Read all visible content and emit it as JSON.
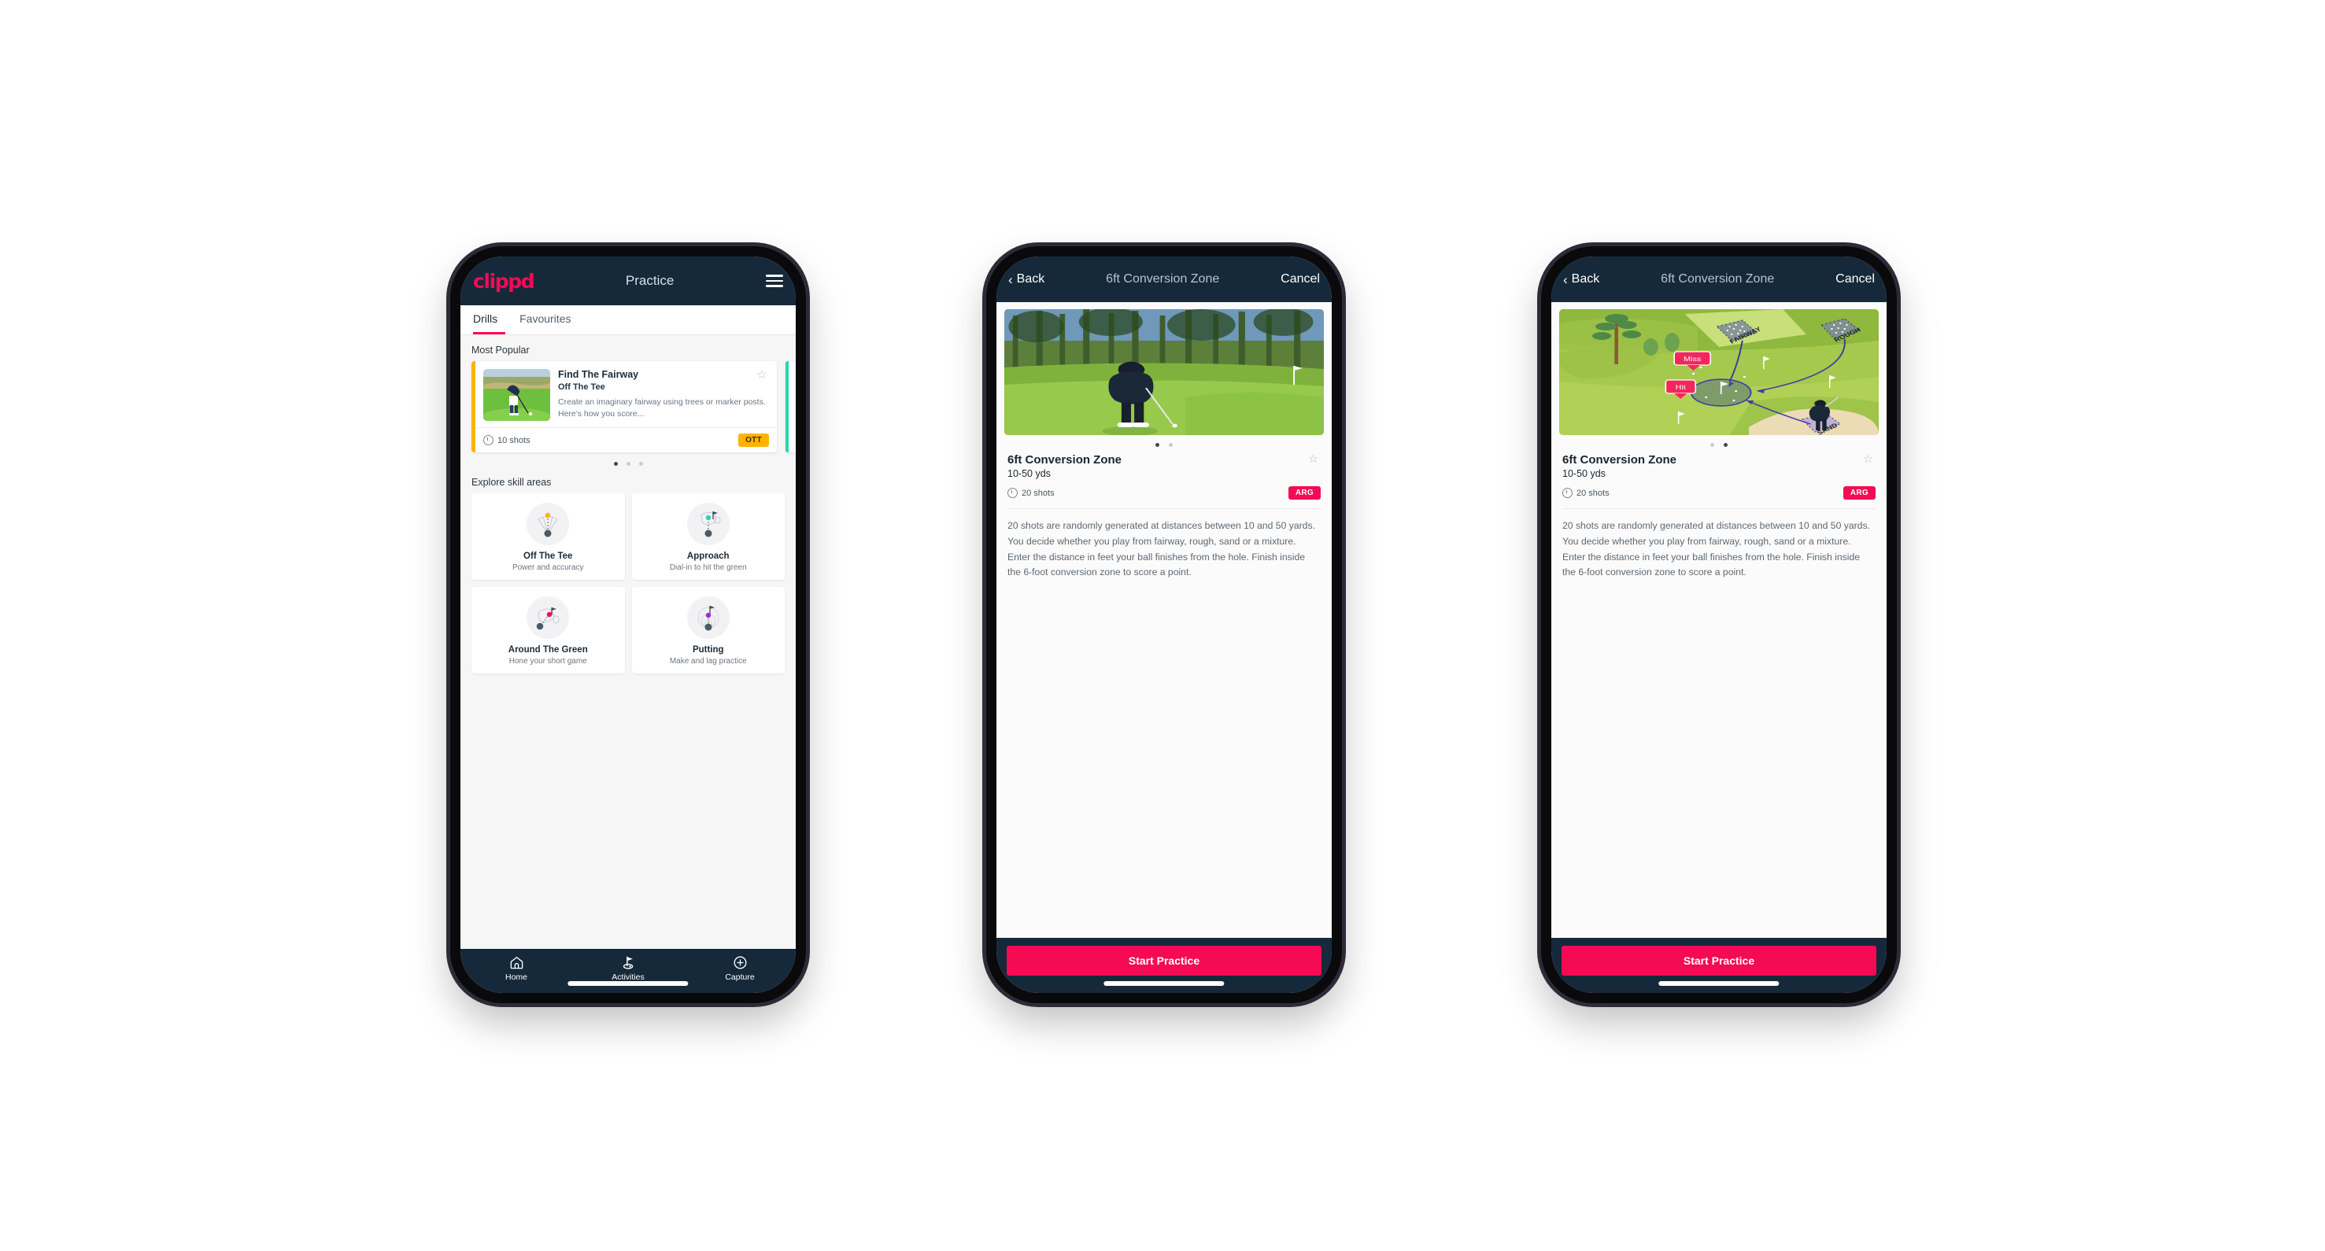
{
  "phone1": {
    "appbar": {
      "brand": "clippd",
      "title": "Practice",
      "menu_icon": "hamburger-menu-icon"
    },
    "tabs": [
      {
        "label": "Drills",
        "active": true
      },
      {
        "label": "Favourites",
        "active": false
      }
    ],
    "sections": {
      "most_popular": "Most Popular",
      "explore": "Explore skill areas"
    },
    "drill": {
      "name": "Find The Fairway",
      "category": "Off The Tee",
      "description": "Create an imaginary fairway using trees or marker posts. Here's how you score...",
      "shots": "10 shots",
      "badge": "OTT",
      "badge_color": "#ffb300",
      "accent_color": "#ffb300",
      "peek_accent_color": "#2ad4b0",
      "star_icon": "star-outline-icon"
    },
    "carousel_dots": {
      "count": 3,
      "active": 0
    },
    "skills": [
      {
        "name": "Off The Tee",
        "desc": "Power and accuracy",
        "icon": "off-the-tee-icon",
        "dot_color": "#ffb300"
      },
      {
        "name": "Approach",
        "desc": "Dial-in to hit the green",
        "icon": "approach-icon",
        "dot_color": "#2ad4b0"
      },
      {
        "name": "Around The Green",
        "desc": "Hone your short game",
        "icon": "around-the-green-icon",
        "dot_color": "#f50a54"
      },
      {
        "name": "Putting",
        "desc": "Make and lag practice",
        "icon": "putting-icon",
        "dot_color": "#a02ae0"
      }
    ],
    "bottom_nav": [
      {
        "label": "Home",
        "icon": "home-icon",
        "active": false
      },
      {
        "label": "Activities",
        "icon": "golf-flag-icon",
        "active": true
      },
      {
        "label": "Capture",
        "icon": "plus-circle-icon",
        "active": false
      }
    ]
  },
  "phone2": {
    "navbar": {
      "back": "Back",
      "title": "6ft Conversion Zone",
      "cancel": "Cancel",
      "back_icon": "chevron-left-icon"
    },
    "hero": {
      "type": "photo",
      "alt": "golfer-chipping-photo"
    },
    "carousel_dots": {
      "count": 2,
      "active": 0
    },
    "detail": {
      "title": "6ft Conversion Zone",
      "distance": "10-50 yds",
      "shots": "20 shots",
      "badge": "ARG",
      "badge_color": "#f50a54",
      "star_icon": "star-outline-icon",
      "description": "20 shots are randomly generated at distances between 10 and 50 yards. You decide whether you play from fairway, rough, sand or a mixture. Enter the distance in feet your ball finishes from the hole. Finish inside the 6-foot conversion zone to score a point."
    },
    "cta": {
      "label": "Start Practice",
      "color": "#f50a54"
    }
  },
  "phone3": {
    "navbar": {
      "back": "Back",
      "title": "6ft Conversion Zone",
      "cancel": "Cancel",
      "back_icon": "chevron-left-icon"
    },
    "hero": {
      "type": "illustration",
      "alt": "golf-course-diagram",
      "labels": {
        "fairway": "FAIRWAY",
        "rough": "ROUGH",
        "sand": "SAND",
        "miss": "Miss",
        "hit": "Hit"
      }
    },
    "carousel_dots": {
      "count": 2,
      "active": 1
    },
    "detail": {
      "title": "6ft Conversion Zone",
      "distance": "10-50 yds",
      "shots": "20 shots",
      "badge": "ARG",
      "badge_color": "#f50a54",
      "star_icon": "star-outline-icon",
      "description": "20 shots are randomly generated at distances between 10 and 50 yards. You decide whether you play from fairway, rough, sand or a mixture. Enter the distance in feet your ball finishes from the hole. Finish inside the 6-foot conversion zone to score a point."
    },
    "cta": {
      "label": "Start Practice",
      "color": "#f50a54"
    }
  }
}
